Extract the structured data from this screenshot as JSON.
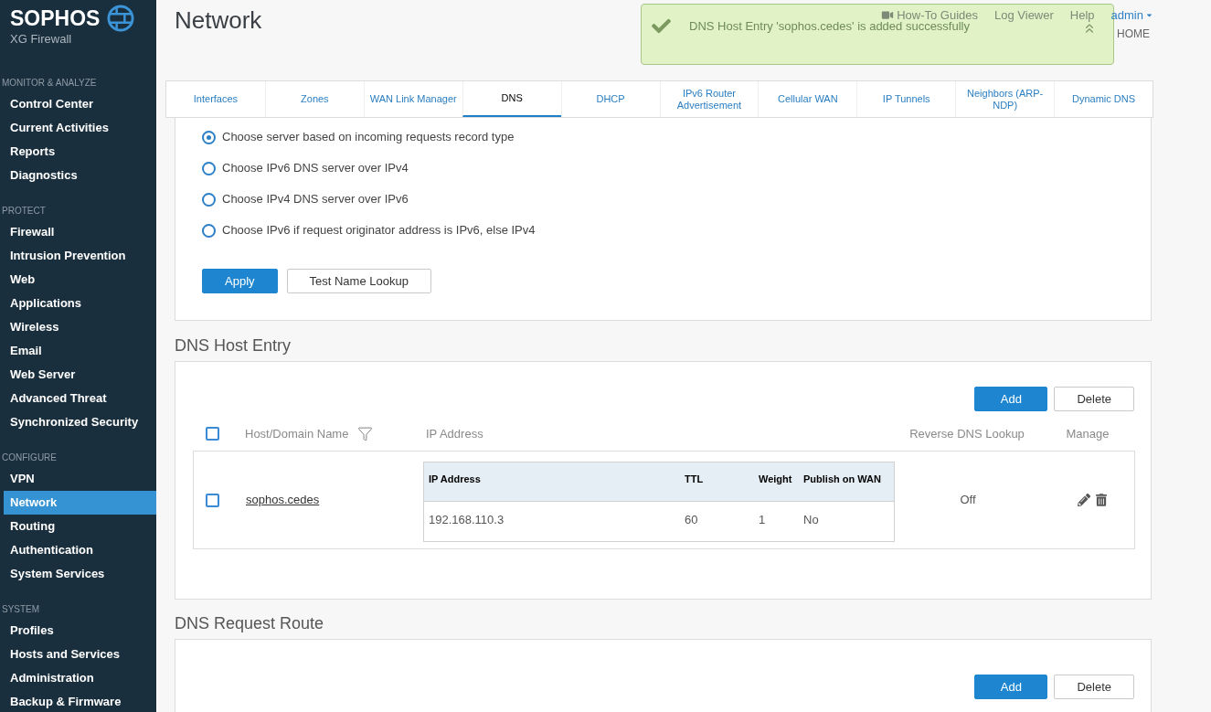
{
  "sidebar": {
    "brand": "SOPHOS",
    "product": "XG Firewall",
    "sections": [
      {
        "title": "MONITOR & ANALYZE",
        "items": [
          {
            "label": "Control Center",
            "selected": false
          },
          {
            "label": "Current Activities",
            "selected": false
          },
          {
            "label": "Reports",
            "selected": false
          },
          {
            "label": "Diagnostics",
            "selected": false
          }
        ]
      },
      {
        "title": "PROTECT",
        "items": [
          {
            "label": "Firewall",
            "selected": false
          },
          {
            "label": "Intrusion Prevention",
            "selected": false
          },
          {
            "label": "Web",
            "selected": false
          },
          {
            "label": "Applications",
            "selected": false
          },
          {
            "label": "Wireless",
            "selected": false
          },
          {
            "label": "Email",
            "selected": false
          },
          {
            "label": "Web Server",
            "selected": false
          },
          {
            "label": "Advanced Threat",
            "selected": false
          },
          {
            "label": "Synchronized Security",
            "selected": false
          }
        ]
      },
      {
        "title": "CONFIGURE",
        "items": [
          {
            "label": "VPN",
            "selected": false
          },
          {
            "label": "Network",
            "selected": true
          },
          {
            "label": "Routing",
            "selected": false
          },
          {
            "label": "Authentication",
            "selected": false
          },
          {
            "label": "System Services",
            "selected": false
          }
        ]
      },
      {
        "title": "SYSTEM",
        "items": [
          {
            "label": "Profiles",
            "selected": false
          },
          {
            "label": "Hosts and Services",
            "selected": false
          },
          {
            "label": "Administration",
            "selected": false
          },
          {
            "label": "Backup & Firmware",
            "selected": false
          }
        ]
      }
    ]
  },
  "header": {
    "title": "Network",
    "guides_link": "How-To Guides",
    "links": [
      "Log Viewer",
      "Help"
    ],
    "user": "admin",
    "location": "HOME"
  },
  "notification": {
    "message": "DNS Host Entry 'sophos.cedes' is added successfully"
  },
  "tabs": [
    {
      "label": "Interfaces",
      "selected": false
    },
    {
      "label": "Zones",
      "selected": false
    },
    {
      "label": "WAN Link Manager",
      "selected": false
    },
    {
      "label": "DNS",
      "selected": true
    },
    {
      "label": "DHCP",
      "selected": false
    },
    {
      "label": "IPv6 Router Advertisement",
      "selected": false
    },
    {
      "label": "Cellular WAN",
      "selected": false
    },
    {
      "label": "IP Tunnels",
      "selected": false
    },
    {
      "label": "Neighbors (ARP-NDP)",
      "selected": false
    },
    {
      "label": "Dynamic DNS",
      "selected": false
    }
  ],
  "ip_preference": {
    "options": [
      {
        "label": "Choose server based on incoming requests record type",
        "selected": true
      },
      {
        "label": "Choose IPv6 DNS server over IPv4",
        "selected": false
      },
      {
        "label": "Choose IPv4 DNS server over IPv6",
        "selected": false
      },
      {
        "label": "Choose IPv6 if request originator address is IPv6, else IPv4",
        "selected": false
      }
    ],
    "buttons": [
      {
        "label": "Apply",
        "kind": "primary"
      },
      {
        "label": "Test Name Lookup",
        "kind": "secondary"
      }
    ]
  },
  "dns_host_entry": {
    "title": "DNS Host Entry",
    "buttons": [
      {
        "label": "Add",
        "kind": "primary"
      },
      {
        "label": "Delete",
        "kind": "secondary"
      }
    ],
    "select_all": {
      "checked": false
    },
    "columns": [
      "Host/Domain Name",
      "IP Address",
      "Reverse DNS Lookup",
      "Manage"
    ],
    "rows": [
      {
        "checked": false,
        "host": "sophos.cedes",
        "addresses": {
          "columns": [
            "IP Address",
            "TTL",
            "Weight",
            "Publish on WAN"
          ],
          "rows": [
            [
              "192.168.110.3",
              "60",
              "1",
              "No"
            ]
          ]
        },
        "reverse_dns": "Off"
      }
    ]
  },
  "dns_request_route": {
    "title": "DNS Request Route",
    "buttons": [
      {
        "label": "Add",
        "kind": "primary"
      },
      {
        "label": "Delete",
        "kind": "secondary"
      }
    ]
  }
}
